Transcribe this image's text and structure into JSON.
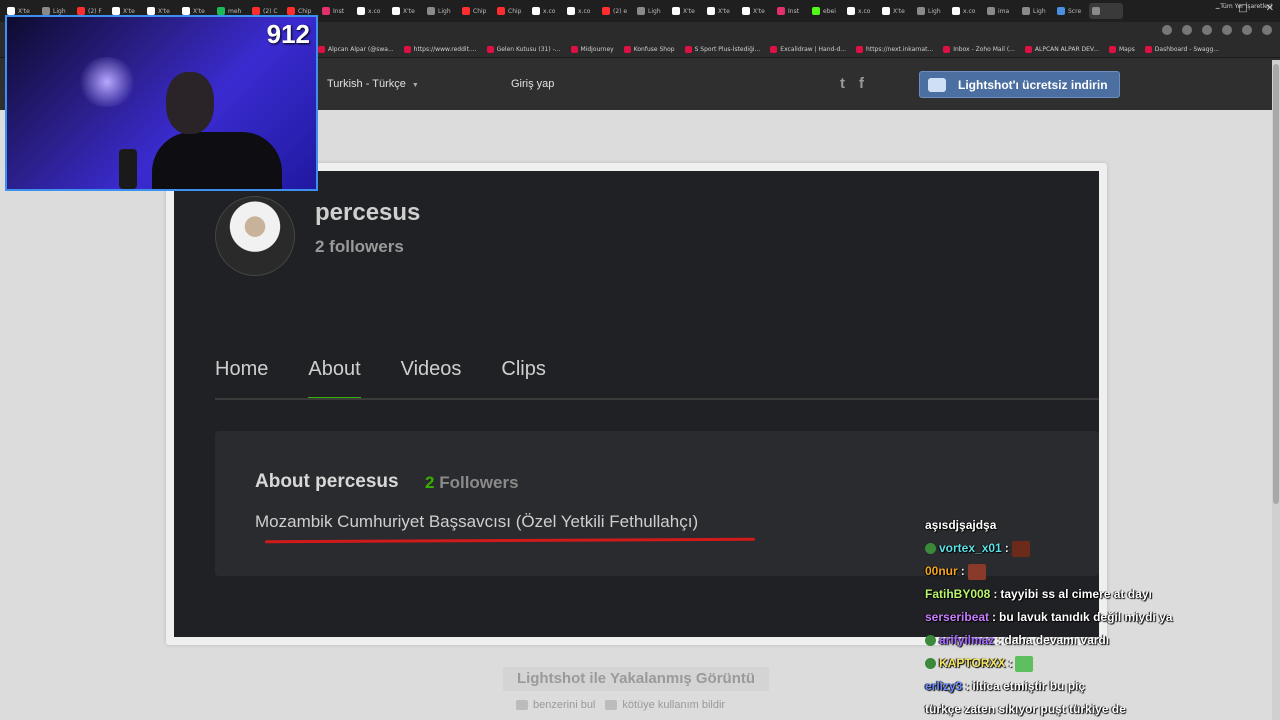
{
  "browser": {
    "tabs": [
      {
        "label": "X'te",
        "color": "#ffffff"
      },
      {
        "label": "Ligh",
        "color": "#8a8a8a"
      },
      {
        "label": "(2) F",
        "color": "#ff2d2d"
      },
      {
        "label": "X'te",
        "color": "#ffffff"
      },
      {
        "label": "X'te",
        "color": "#ffffff"
      },
      {
        "label": "X'te",
        "color": "#ffffff"
      },
      {
        "label": "meh",
        "color": "#1db954"
      },
      {
        "label": "(2) C",
        "color": "#ff2d2d"
      },
      {
        "label": "Chip",
        "color": "#ff2d2d"
      },
      {
        "label": "İnst",
        "color": "#e1306c"
      },
      {
        "label": "x.co",
        "color": "#ffffff"
      },
      {
        "label": "X'te",
        "color": "#ffffff"
      },
      {
        "label": "Ligh",
        "color": "#8a8a8a"
      },
      {
        "label": "Chip",
        "color": "#ff2d2d"
      },
      {
        "label": "Chip",
        "color": "#ff2d2d"
      },
      {
        "label": "x.co",
        "color": "#ffffff"
      },
      {
        "label": "x.co",
        "color": "#ffffff"
      },
      {
        "label": "(2) e",
        "color": "#ff2d2d"
      },
      {
        "label": "Ligh",
        "color": "#8a8a8a"
      },
      {
        "label": "X'te",
        "color": "#ffffff"
      },
      {
        "label": "X'te",
        "color": "#ffffff"
      },
      {
        "label": "X'te",
        "color": "#ffffff"
      },
      {
        "label": "İnst",
        "color": "#e1306c"
      },
      {
        "label": "ebei",
        "color": "#53fc18"
      },
      {
        "label": "x.co",
        "color": "#ffffff"
      },
      {
        "label": "X'te",
        "color": "#ffffff"
      },
      {
        "label": "Ligh",
        "color": "#8a8a8a"
      },
      {
        "label": "x.co",
        "color": "#ffffff"
      },
      {
        "label": "ima",
        "color": "#8a8a8a"
      },
      {
        "label": "Ligh",
        "color": "#8a8a8a"
      },
      {
        "label": "Scre",
        "color": "#4a90e2"
      },
      {
        "label": "",
        "color": "#8a8a8a",
        "active": true
      }
    ],
    "bookmarks": [
      "Alpcan Alpar (@swa...",
      "https://www.reddit....",
      "Gelen Kutusu (31) -...",
      "Midjourney",
      "Konfuse Shop",
      "S Sport Plus-İstediği...",
      "Excalidraw | Hand-d...",
      "https://next.inkarnat...",
      "Inbox - Zoho Mail (...",
      "ALPCAN ALPAR DEV...",
      "Maps",
      "Dashboard - Swagg..."
    ],
    "bookmarks_right": "Tüm Yer İşaretleri"
  },
  "header": {
    "language": "Turkish - Türkçe",
    "login": "Giriş yap",
    "download_button": "Lightshot'ı ücretsiz indirin",
    "twitter_icon": "t",
    "facebook_icon": "f"
  },
  "profile": {
    "name": "percesus",
    "followers": "2 followers",
    "tabs": [
      "Home",
      "About",
      "Videos",
      "Clips"
    ],
    "active_tab": "About",
    "about_title": "About percesus",
    "about_count_num": "2",
    "about_count_label": "Followers",
    "bio": "Mozambik Cumhuriyet Başsavcısı (Özel Yetkili Fethullahçı)"
  },
  "footer": {
    "caption": "Lightshot ile Yakalanmış Görüntü",
    "similar": "benzerini bul",
    "report": "kötüye kullanım bildir"
  },
  "webcam": {
    "counter": "912"
  },
  "chat": [
    {
      "user": "aşısdjşajdşa",
      "text": "",
      "color": "#ffffff",
      "badge": null,
      "emote": null
    },
    {
      "user": "vortex_x01",
      "text": "",
      "color": "#5ce1e6",
      "badge": "#3a8a3a",
      "emote": "#6b2a1a"
    },
    {
      "user": "00nur",
      "text": "",
      "color": "#f5a623",
      "badge": null,
      "emote": "#8a3a2a"
    },
    {
      "user": "FatihBY008",
      "text": "tayyibi ss al cimere at dayı",
      "color": "#b8f56b",
      "badge": null,
      "emote": null
    },
    {
      "user": "serseribeat",
      "text": "bu lavuk tanıdık değil miydi ya",
      "color": "#c77dff",
      "badge": null,
      "emote": null
    },
    {
      "user": "arifyilmaz",
      "text": "daha devamı vardı",
      "color": "#a66bff",
      "badge": "#3a8a3a",
      "emote": null
    },
    {
      "user": "KAPTORXX",
      "text": "",
      "color": "#f5e663",
      "badge": "#3a8a3a",
      "emote": "#5fbf5f"
    },
    {
      "user": "erlizy3",
      "text": "iltica etmiştir bu piç",
      "color": "#6b8cff",
      "badge": null,
      "emote": null
    },
    {
      "user": "",
      "text": "türkçe zaten sıkıyor puşt türkiye de",
      "color": "#ffffff",
      "badge": null,
      "emote": null
    }
  ]
}
